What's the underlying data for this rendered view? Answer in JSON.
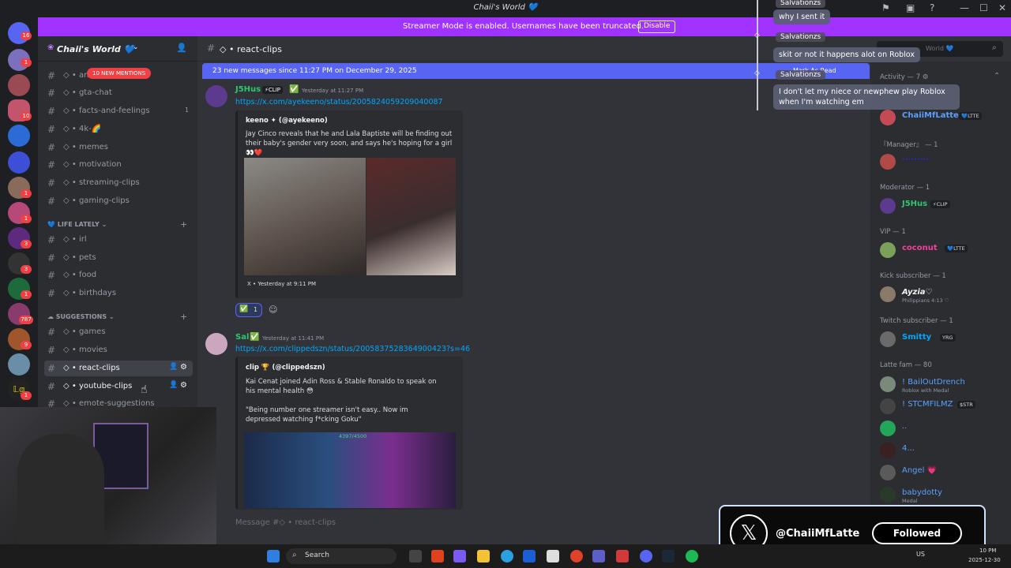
{
  "window": {
    "title": "Chaii's World 💙",
    "controls": [
      "—",
      "☐",
      "✕"
    ]
  },
  "banner": {
    "text": "Streamer Mode is enabled. Usernames have been truncated.",
    "button": "Disable"
  },
  "guild_badges": [
    "16",
    "1",
    "10",
    "1",
    "1",
    "3",
    "3",
    "1",
    "787",
    "9",
    "1"
  ],
  "server": {
    "name": "Chaii's World 💙",
    "mentions_pill": "10 NEW MENTIONS"
  },
  "channels": {
    "top": [
      {
        "label": "ani",
        "count": ""
      },
      {
        "label": "gta-chat",
        "count": ""
      },
      {
        "label": "facts-and-feelings",
        "count": "1"
      },
      {
        "label": "4k-🌈",
        "count": ""
      },
      {
        "label": "memes",
        "count": ""
      },
      {
        "label": "motivation",
        "count": ""
      },
      {
        "label": "streaming-clips",
        "count": ""
      },
      {
        "label": "gaming-clips",
        "count": ""
      }
    ],
    "cat_life": "LIFE LATELY",
    "life": [
      "irl",
      "pets",
      "food",
      "birthdays"
    ],
    "cat_suggestions": "SUGGESTIONS",
    "suggestions": [
      "games",
      "movies",
      "react-clips",
      "youtube-clips",
      "emote-suggestions"
    ]
  },
  "chat": {
    "channel": "react-clips",
    "new_messages": "23 new messages since 11:27 PM on December 29, 2025",
    "mark_as_read": "Mark As Read",
    "composer_placeholder": "Message #◇ • react-clips"
  },
  "messages": [
    {
      "author": "J5Hus",
      "badge": "⚡CLIP",
      "timestamp": "Yesterday at 11:27 PM",
      "link": "https://x.com/ayekeeno/status/2005824059209040087",
      "embed_author": "keeno ✦ (@ayekeeno)",
      "embed_text": "Jay Cinco reveals that he and Lala Baptiste will be finding out their baby's gender very soon, and says he's hoping for a girl👀❤️",
      "embed_footer": "X • Yesterday at 9:11 PM",
      "reaction": "✅",
      "reaction_count": "1"
    },
    {
      "author": "Sal",
      "timestamp": "Yesterday at 11:41 PM",
      "link": "https://x.com/clippedszn/status/2005837528364900423?s=46",
      "embed_author": "clip 🏆 (@clippedszn)",
      "embed_text_1": "Kai Cenat joined Adin Ross & Stable Ronaldo to speak on his mental health 😳",
      "embed_text_2": "\"Being number one streamer isn't easy.. Now im depressed watching f*cking Goku\"",
      "image_counter": "4397/4500"
    }
  ],
  "overlay_chat": [
    {
      "name": "Salvationzs",
      "msg": "why I sent it"
    },
    {
      "name": "Salvationzs",
      "msg": "skit or not it happens alot on Roblox"
    },
    {
      "name": "Salvationzs",
      "msg": "I don't let my niece or newphew play Roblox when I'm watching em"
    }
  ],
  "members": {
    "search_placeholder": "World 💙",
    "activity": "Activity — 7 ⚙",
    "entries": [
      {
        "type": "member",
        "name": "ChaiiMfLatte",
        "color": "#5ba0ff",
        "tag": "💙LTTE"
      },
      {
        "type": "head",
        "text": "『Manager』 — 1"
      },
      {
        "type": "member",
        "name": "·········",
        "color": "#2727d6",
        "tag": ""
      },
      {
        "type": "head",
        "text": "Moderator — 1"
      },
      {
        "type": "member",
        "name": "J5Hus",
        "color": "#2dc770",
        "tag": "⚡CLIP"
      },
      {
        "type": "head",
        "text": "VIP — 1"
      },
      {
        "type": "member",
        "name": "coconut",
        "color": "#f23f9f",
        "tag": "💙LTTE"
      },
      {
        "type": "head",
        "text": "Kick subscriber — 1"
      },
      {
        "type": "member",
        "name": "Ayzia♡",
        "color": "#f2f3f5",
        "tag": "",
        "sub": "Philippians 4:13 ♡"
      },
      {
        "type": "head",
        "text": "Twitch subscriber — 1"
      },
      {
        "type": "member",
        "name": "Smitty",
        "color": "#00a8fc",
        "tag": "YRG"
      },
      {
        "type": "head",
        "text": "Latte fam — 80"
      },
      {
        "type": "member",
        "name": "! BailOutDrench",
        "color": "#5ba0ff",
        "tag": "",
        "sub": "Roblox with Medal"
      },
      {
        "type": "member",
        "name": "! STCMFILMZ",
        "color": "#5ba0ff",
        "tag": "$STR"
      },
      {
        "type": "member",
        "name": "..",
        "color": "#5ba0ff",
        "tag": ""
      },
      {
        "type": "member",
        "name": "4...",
        "color": "#5ba0ff",
        "tag": ""
      },
      {
        "type": "member",
        "name": "Angel 💗",
        "color": "#5ba0ff",
        "tag": ""
      },
      {
        "type": "member",
        "name": "babydotty",
        "color": "#5ba0ff",
        "tag": "",
        "sub": "Medal"
      }
    ]
  },
  "toast": {
    "handle": "@ChaiiMfLatte",
    "button": "Followed"
  },
  "taskbar": {
    "search": "Search",
    "lang": "US",
    "time": "10 PM",
    "date": "2025-12-30"
  }
}
